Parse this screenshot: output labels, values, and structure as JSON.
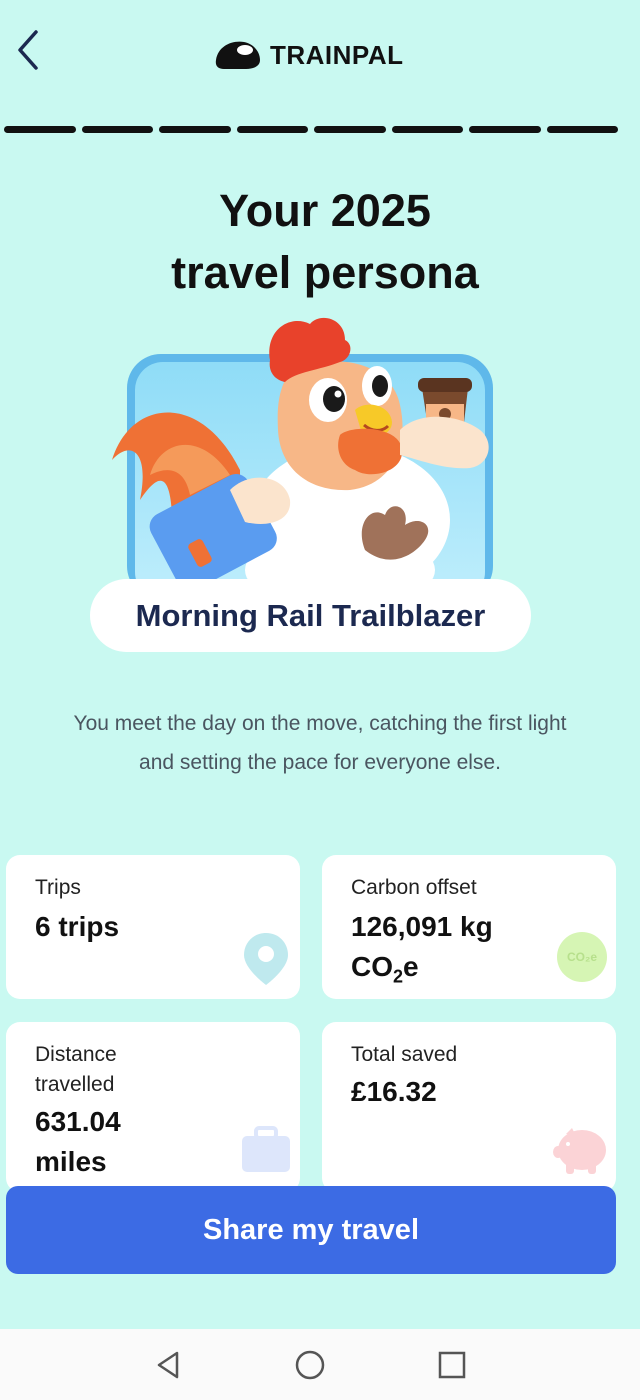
{
  "header": {
    "brand": "TRAINPAL",
    "icons": {
      "back": "chevron-left-icon",
      "logo": "train-logo-icon"
    }
  },
  "progress": {
    "segments": 8,
    "completed": 8
  },
  "page": {
    "title_line1": "Your 2025",
    "title_line2": "travel persona"
  },
  "persona": {
    "name": "Morning Rail Trailblazer",
    "description_line1": "You meet the day on the move, catching the first light",
    "description_line2": "and setting the pace for everyone else."
  },
  "stats": {
    "trips": {
      "label": "Trips",
      "value": "6 trips",
      "icon": "location-pin-icon"
    },
    "carbon": {
      "label": "Carbon offset",
      "value_line1": "126,091 kg",
      "value_co": "CO",
      "value_sub": "2",
      "value_e": "e",
      "icon_text": "CO₂e",
      "icon": "co2-badge-icon"
    },
    "distance": {
      "label_line1": "Distance",
      "label_line2": "travelled",
      "value_line1": "631.04",
      "value_line2": "miles",
      "icon": "suitcase-icon"
    },
    "saved": {
      "label": "Total saved",
      "value": "£16.32",
      "icon": "piggy-bank-icon"
    }
  },
  "actions": {
    "share_label": "Share my travel"
  },
  "system_nav": {
    "icons": [
      "back-triangle-icon",
      "home-circle-icon",
      "recents-square-icon"
    ]
  },
  "colors": {
    "background": "#c9f9f1",
    "accent": "#3c6be4",
    "persona_text": "#1c2950",
    "card": "#ffffff"
  }
}
